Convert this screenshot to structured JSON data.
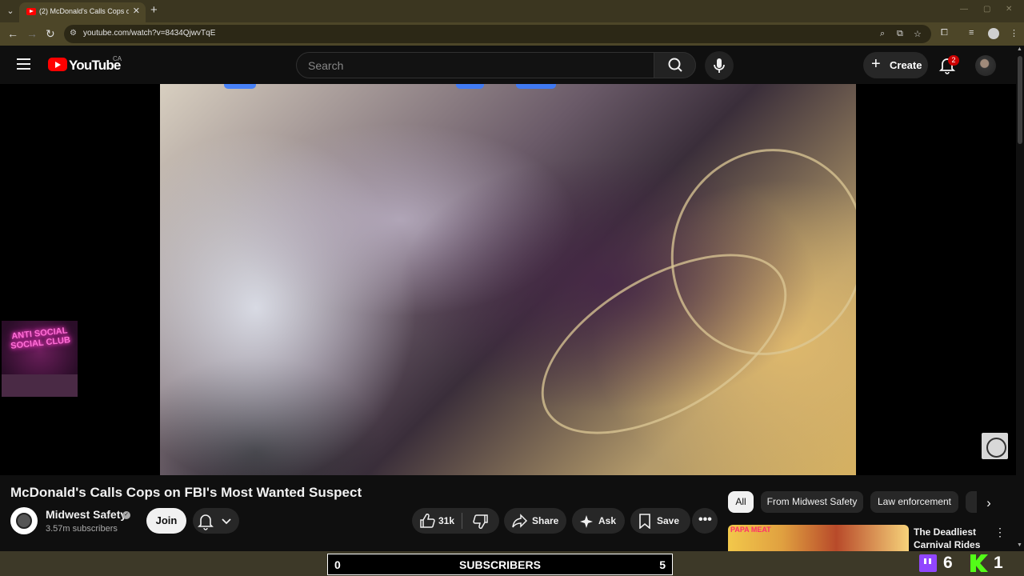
{
  "browser": {
    "tab_title": "(2) McDonald's Calls Cops on FBI's Most Wanted Suspect",
    "url": "youtube.com/watch?v=8434QjwvTqE",
    "new_tab": "+",
    "tab_close": "✕"
  },
  "header": {
    "brand": "YouTube",
    "region": "CA",
    "search_placeholder": "Search",
    "create_label": "Create",
    "notification_count": "2"
  },
  "video": {
    "title": "McDonald's Calls Cops on FBI's Most Wanted Suspect",
    "pip_sign": "ANTI SOCIAL SOCIAL CLUB"
  },
  "channel": {
    "name": "Midwest Safety",
    "subscribers": "3.57m subscribers",
    "join_label": "Join"
  },
  "actions": {
    "likes": "31k",
    "share_label": "Share",
    "ask_label": "Ask",
    "save_label": "Save"
  },
  "chips": [
    "All",
    "From Midwest Safety",
    "Law enforcement"
  ],
  "recommendation": {
    "title": "The Deadliest Carnival Rides",
    "thumb_tag": "PAPA MEAT"
  },
  "overlay": {
    "counter_left": "0",
    "counter_label": "SUBSCRIBERS",
    "counter_right": "5",
    "twitch_count": "6",
    "kick_count": "1"
  },
  "colors": {
    "yt_red": "#ff0000",
    "background": "#0f0f0f",
    "twitch": "#9146ff",
    "kick": "#53fc18"
  }
}
